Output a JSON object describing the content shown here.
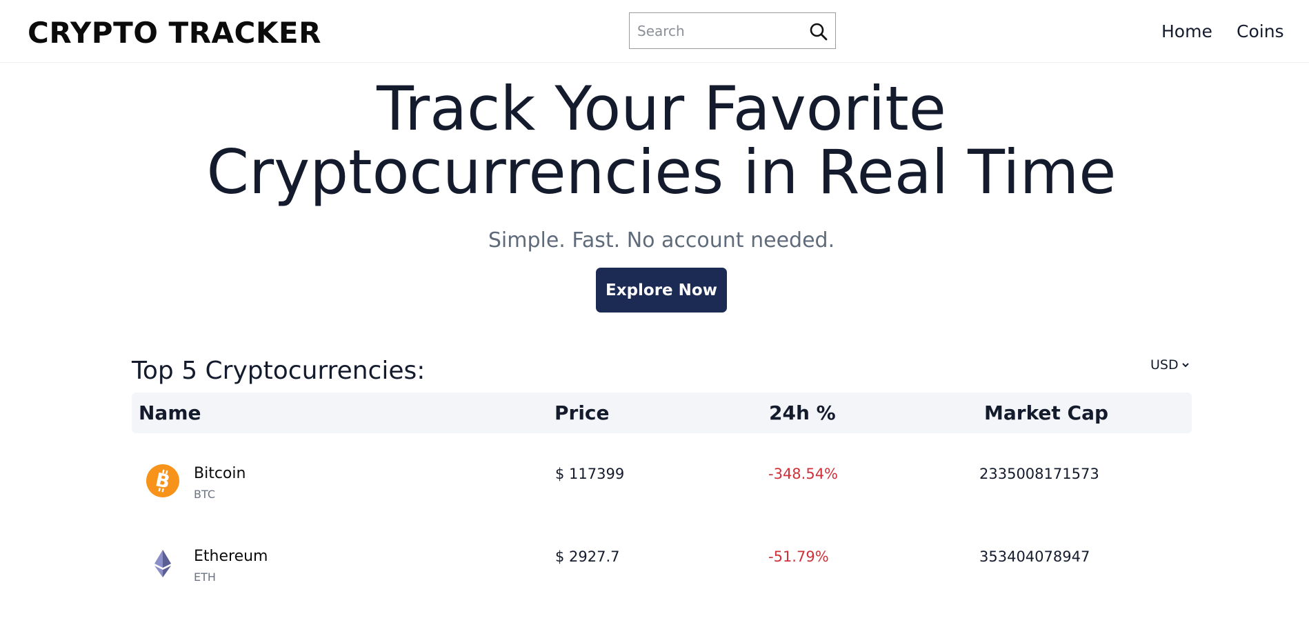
{
  "header": {
    "brand": "CRYPTO TRACKER",
    "search_placeholder": "Search",
    "nav": [
      {
        "label": "Home"
      },
      {
        "label": "Coins"
      }
    ]
  },
  "hero": {
    "title_line1": "Track Your Favorite",
    "title_line2": "Cryptocurrencies in Real Time",
    "subtitle": "Simple. Fast. No account needed.",
    "cta_label": "Explore Now"
  },
  "market": {
    "section_title": "Top 5 Cryptocurrencies:",
    "currency": "USD",
    "columns": {
      "name": "Name",
      "price": "Price",
      "change": "24h %",
      "market_cap": "Market Cap"
    },
    "rows": [
      {
        "name": "Bitcoin",
        "symbol": "BTC",
        "price": "$ 117399",
        "change": "-348.54%",
        "market_cap": "2335008171573",
        "icon": "bitcoin-icon"
      },
      {
        "name": "Ethereum",
        "symbol": "ETH",
        "price": "$ 2927.7",
        "change": "-51.79%",
        "market_cap": "353404078947",
        "icon": "ethereum-icon"
      }
    ]
  },
  "colors": {
    "accent": "#1c2b54",
    "negative": "#d0303a",
    "bitcoin": "#f7931a",
    "ethereum": "#6b6fa8"
  }
}
